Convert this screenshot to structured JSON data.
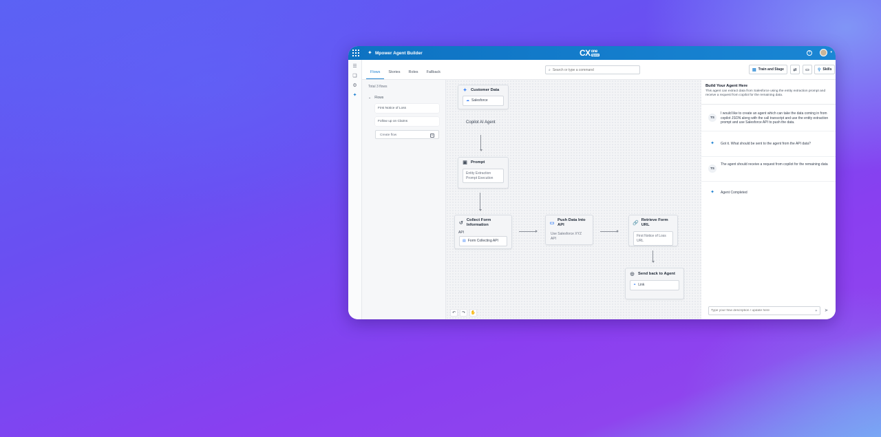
{
  "app": {
    "title": "Mpower Agent Builder",
    "brand_main": "CX",
    "brand_sub": "one",
    "brand_tag": "Mpower"
  },
  "tabs": [
    "Flows",
    "Stories",
    "Roles",
    "Fallback"
  ],
  "flows_panel": {
    "total": "Total 3 flows",
    "section": "Flows",
    "items": [
      "First Notice of Loss",
      "Follow up on Claims"
    ],
    "create_label": "Create flow"
  },
  "toolbar": {
    "search_placeholder": "Search or type a command",
    "train_label": "Train and Stage",
    "skills_label": "Skills"
  },
  "canvas": {
    "customer_data": {
      "title": "Customer Data",
      "source": "Salesforce"
    },
    "copilot_label": "Copilot AI Agent",
    "prompt": {
      "title": "Prompt",
      "body": "Entity Extraction Prompt Execution"
    },
    "collect_form": {
      "title": "Collect Form Information",
      "sub": "API",
      "body": "Form Collecting API"
    },
    "push_data": {
      "title": "Push Data Into API",
      "body": "Use Salesforce XYZ API"
    },
    "retrieve_form": {
      "title": "Retrieve Form URL",
      "body": "First Notice of Loss URL"
    },
    "send_back": {
      "title": "Send back to Agent",
      "body": "Link"
    }
  },
  "chat": {
    "title": "Build Your Agent Here",
    "description": "This agent can extract data from Salesforce using the entity extraction prompt and receive a request from copilot for the remaining data.",
    "user_initials": "TS",
    "messages": [
      "I would like to create an agent which can take the data coming in from copilot JSON along with the call transcript and use the entity extraction prompt and use Salesforce API to push the data.",
      "Got it. What should be sent to the agent from the API data?",
      "The agent should receive a request from copilot for the remaining data",
      "Agent Completed"
    ],
    "input_placeholder": "Type your flow description / update here"
  },
  "colors": {
    "accent": "#1a7fd0",
    "titlebar": "#0d72c2"
  }
}
